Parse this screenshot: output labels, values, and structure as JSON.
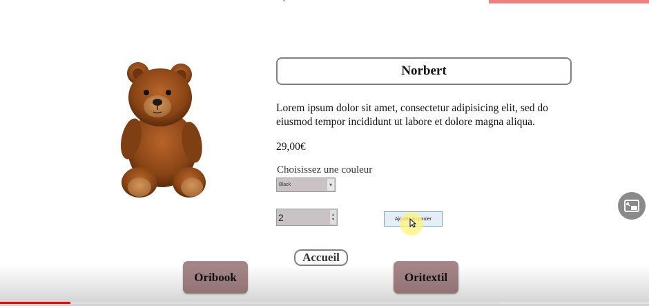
{
  "product": {
    "name": "Norbert",
    "description": "Lorem ipsum dolor sit amet, consectetur adipisicing elit, sed do eiusmod tempor incididunt ut labore et dolore magna aliqua.",
    "price": "29,00€",
    "image_icon": "teddy-bear-image"
  },
  "options": {
    "color_label": "Choisissez une couleur",
    "color_selected": "Black",
    "quantity": "2"
  },
  "actions": {
    "add_to_cart": "Ajouter au panier",
    "home_link": "Accueil"
  },
  "nav": {
    "left": "Oribook",
    "right": "Oritextil"
  },
  "video_player": {
    "progress_played": 0.109,
    "progress_buffered": 0.77,
    "pip_icon": "picture-in-picture-icon",
    "colors": {
      "played": "#ff0000",
      "accent_top": "#f08080"
    }
  },
  "colors": {
    "button_bg": "#a68487",
    "border": "#8c7a7f",
    "add_button_bg": "#e4eef6",
    "add_button_border": "#7aa6c6"
  }
}
